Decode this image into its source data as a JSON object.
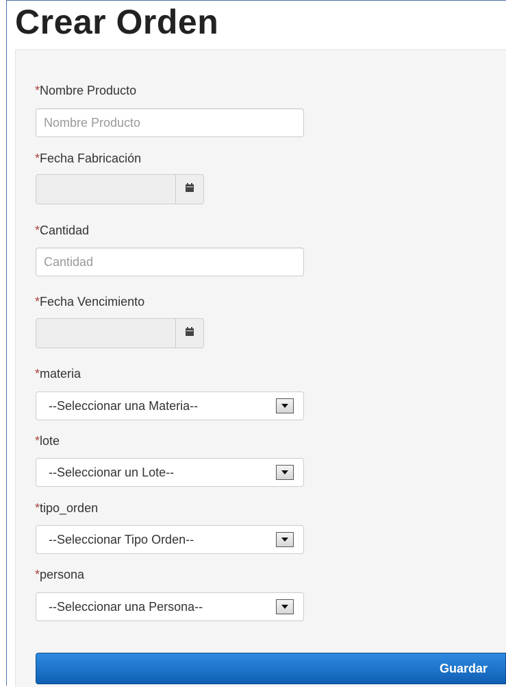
{
  "page": {
    "title": "Crear Orden"
  },
  "form": {
    "required_mark": "*",
    "nombre_producto": {
      "label": "Nombre Producto",
      "placeholder": "Nombre Producto",
      "value": ""
    },
    "fecha_fabricacion": {
      "label": "Fecha Fabricación",
      "value": "",
      "icon": "calendar-icon"
    },
    "cantidad": {
      "label": "Cantidad",
      "placeholder": "Cantidad",
      "value": ""
    },
    "fecha_vencimiento": {
      "label": "Fecha Vencimiento",
      "value": "",
      "icon": "calendar-icon"
    },
    "materia": {
      "label": "materia",
      "selected": "--Seleccionar una Materia--"
    },
    "lote": {
      "label": "lote",
      "selected": "--Seleccionar un Lote--"
    },
    "tipo_orden": {
      "label": "tipo_orden",
      "selected": "--Seleccionar Tipo Orden--"
    },
    "persona": {
      "label": "persona",
      "selected": "--Seleccionar una Persona--"
    },
    "submit_label": "Guardar"
  },
  "colors": {
    "required": "#a94442",
    "primary": "#1a6fc7",
    "panel": "#f5f5f5"
  }
}
